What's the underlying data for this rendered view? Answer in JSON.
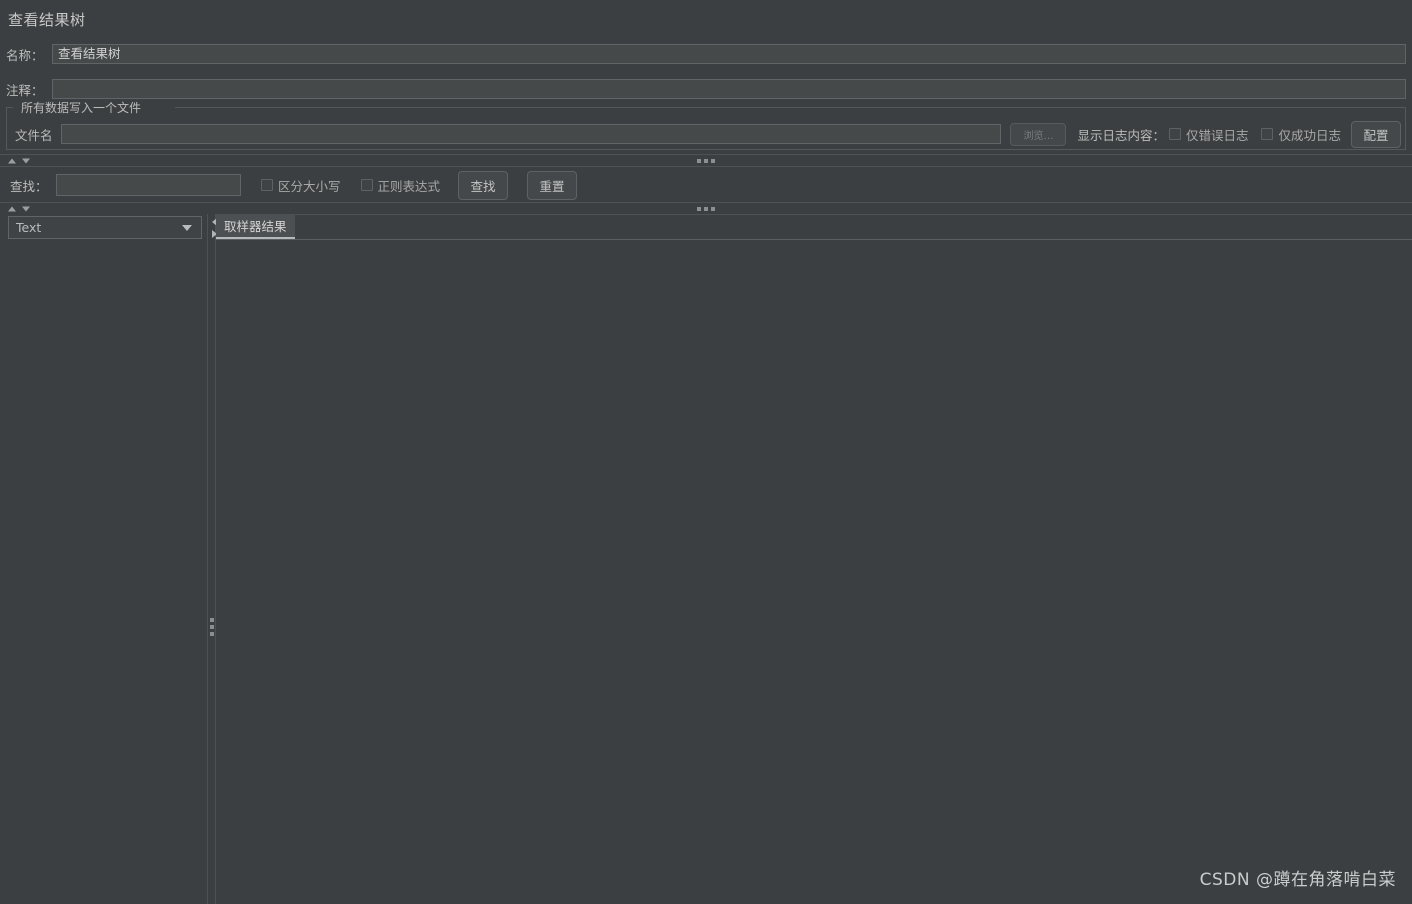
{
  "panel": {
    "title": "查看结果树"
  },
  "fields": {
    "name_label": "名称：",
    "name_value": "查看结果树",
    "comment_label": "注释：",
    "comment_value": ""
  },
  "file_group": {
    "legend": "所有数据写入一个文件",
    "filename_label": "文件名",
    "filename_value": "",
    "browse_button": "浏览…",
    "log_display_label": "显示日志内容：",
    "errors_only_label": "仅错误日志",
    "errors_only_checked": false,
    "success_only_label": "仅成功日志",
    "success_only_checked": false,
    "configure_button": "配置"
  },
  "search": {
    "label": "查找：",
    "value": "",
    "case_sensitive_label": "区分大小写",
    "case_sensitive_checked": false,
    "regex_label": "正则表达式",
    "regex_checked": false,
    "search_button": "查找",
    "reset_button": "重置"
  },
  "results": {
    "render_selected": "Text",
    "tab_label": "取样器结果"
  },
  "watermark": {
    "text": "CSDN @蹲在角落啃白菜"
  },
  "colors": {
    "background": "#3c3f41",
    "field_background": "#45494a",
    "border": "#606466",
    "text": "#bcbcbc",
    "tab_active": "#4d5052"
  }
}
